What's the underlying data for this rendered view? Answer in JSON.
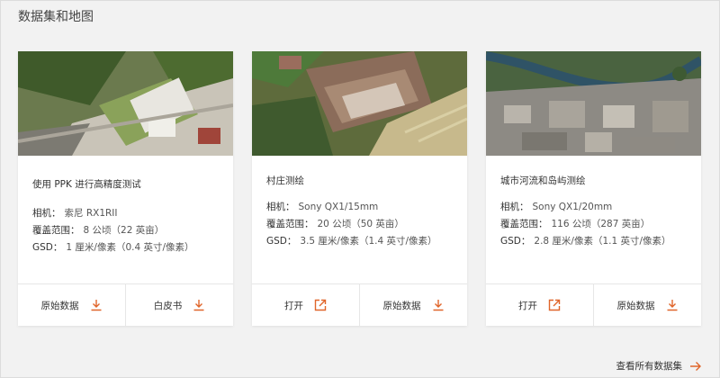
{
  "section": {
    "title": "数据集和地图"
  },
  "accent_color": "#e0652a",
  "cards": [
    {
      "title": "使用 PPK 进行高精度测试",
      "specs": [
        {
          "key": "相机：",
          "value": "索尼 RX1RII"
        },
        {
          "key": "覆盖范围：",
          "value": "8 公顷（22 英亩）"
        },
        {
          "key": "GSD：",
          "value": "1 厘米/像素（0.4 英寸/像素）"
        }
      ],
      "actions": [
        {
          "label": "原始数据",
          "icon": "download-icon"
        },
        {
          "label": "白皮书",
          "icon": "download-icon"
        }
      ]
    },
    {
      "title": "村庄测绘",
      "specs": [
        {
          "key": "相机：",
          "value": "Sony QX1/15mm"
        },
        {
          "key": "覆盖范围：",
          "value": "20 公顷（50 英亩）"
        },
        {
          "key": "GSD：",
          "value": "3.5 厘米/像素（1.4 英寸/像素）"
        }
      ],
      "actions": [
        {
          "label": "打开",
          "icon": "external-link-icon"
        },
        {
          "label": "原始数据",
          "icon": "download-icon"
        }
      ]
    },
    {
      "title": "城市河流和岛屿测绘",
      "specs": [
        {
          "key": "相机：",
          "value": "Sony QX1/20mm"
        },
        {
          "key": "覆盖范围：",
          "value": "116 公顷（287 英亩）"
        },
        {
          "key": "GSD：",
          "value": "2.8 厘米/像素（1.1 英寸/像素）"
        }
      ],
      "actions": [
        {
          "label": "打开",
          "icon": "external-link-icon"
        },
        {
          "label": "原始数据",
          "icon": "download-icon"
        }
      ]
    }
  ],
  "footer": {
    "view_all": "查看所有数据集"
  }
}
